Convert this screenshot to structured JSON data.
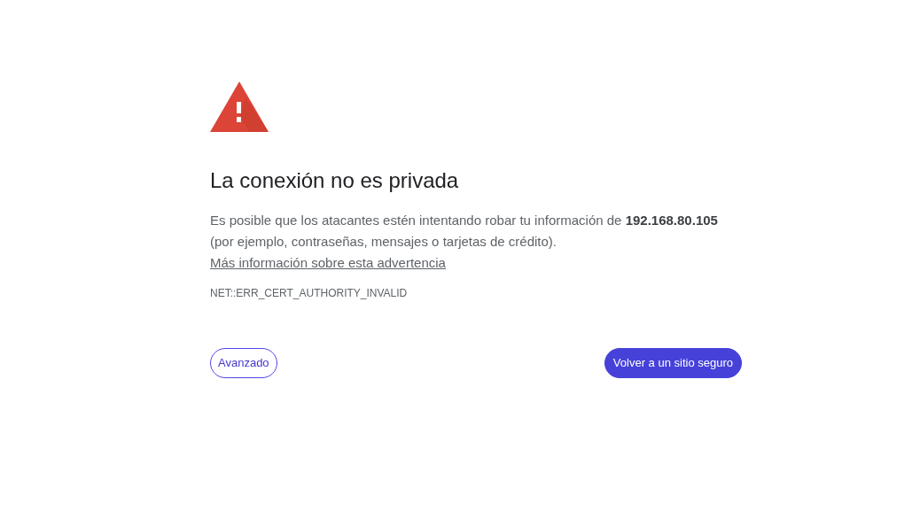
{
  "heading": "La conexión no es privada",
  "message": "Es posible que los atacantes estén intentando robar tu información de **192.168.80.105** (por ejemplo, contraseñas, mensajes o tarjetas de crédito).",
  "learn_more_link": "Más información sobre esta advertencia",
  "error_code": "NET::ERR_CERT_AUTHORITY_INVALID",
  "buttons": [
    {
      "label": "Avanzado",
      "kind": "outline"
    },
    {
      "label": "Volver a un sitio seguro",
      "kind": "primary"
    }
  ]
}
